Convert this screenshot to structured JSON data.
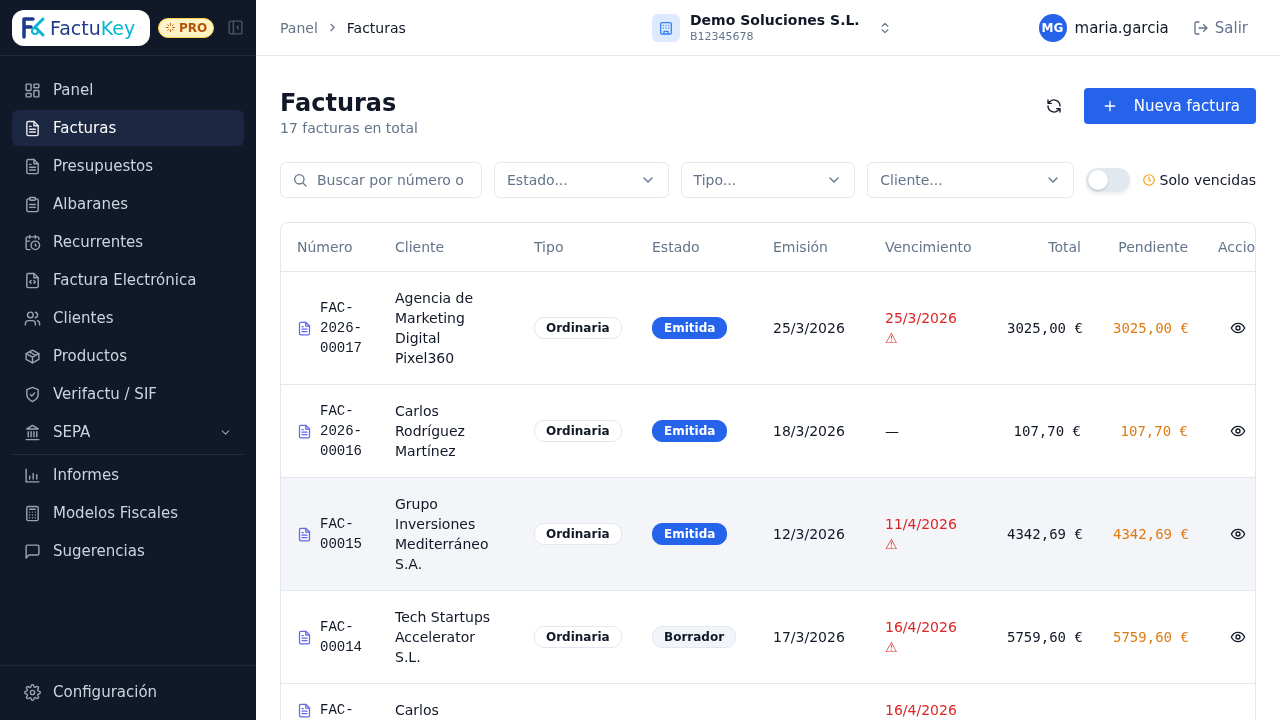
{
  "sidebar": {
    "logo": {
      "part_1": "Factu",
      "part_2": "Key"
    },
    "plan_badge": "PRO",
    "items": [
      {
        "label": "Panel",
        "selected": false
      },
      {
        "label": "Facturas",
        "selected": true
      },
      {
        "label": "Presupuestos",
        "selected": false
      },
      {
        "label": "Albaranes",
        "selected": false
      },
      {
        "label": "Recurrentes",
        "selected": false
      },
      {
        "label": "Factura Electrónica",
        "selected": false
      },
      {
        "label": "Clientes",
        "selected": false
      },
      {
        "label": "Productos",
        "selected": false
      },
      {
        "label": "Verifactu / SIF",
        "selected": false
      },
      {
        "label": "SEPA",
        "selected": false,
        "expanded": false
      },
      {
        "label": "Informes",
        "selected": false
      },
      {
        "label": "Modelos Fiscales",
        "selected": false
      },
      {
        "label": "Sugerencias",
        "selected": false
      }
    ],
    "footer_item": {
      "label": "Configuración",
      "selected": false
    }
  },
  "header": {
    "breadcrumb": [
      "Panel",
      "Facturas"
    ],
    "company": {
      "name": "Demo Soluciones S.L.",
      "tax_id": "B12345678"
    },
    "user": {
      "initials": "MG",
      "name": "maria.garcia"
    },
    "logout": "Salir"
  },
  "page": {
    "title": "Facturas",
    "subtitle": "17 facturas en total",
    "new_button": "Nueva factura"
  },
  "filters": {
    "search": {
      "placeholder": "Buscar por número o"
    },
    "selects": [
      {
        "placeholder": "Estado..."
      },
      {
        "placeholder": "Tipo..."
      },
      {
        "placeholder": "Cliente..."
      }
    ],
    "overdue_toggle": {
      "label": "Solo vencidas",
      "on": false
    }
  },
  "table": {
    "columns": [
      "Número",
      "Cliente",
      "Tipo",
      "Estado",
      "Emisión",
      "Vencimiento",
      "Total",
      "Pendiente",
      "Accio"
    ],
    "rows": [
      {
        "number": "FAC-2026-00017",
        "client": "Agencia de Marketing Digital Pixel360",
        "type": "Ordinaria",
        "status": {
          "label": "Emitida",
          "kind": "issued"
        },
        "issued": "25/3/2026",
        "due": "25/3/2026",
        "overdue": true,
        "due_flag": "⚠",
        "total": "3025,00 €",
        "pending": "3025,00 €",
        "highlighted": false
      },
      {
        "number": "FAC-2026-00016",
        "client": "Carlos Rodríguez Martínez",
        "type": "Ordinaria",
        "status": {
          "label": "Emitida",
          "kind": "issued"
        },
        "issued": "18/3/2026",
        "due": "—",
        "overdue": false,
        "total": "107,70 €",
        "pending": "107,70 €",
        "highlighted": false
      },
      {
        "number": "FAC-00015",
        "client": "Grupo Inversiones Mediterráneo S.A.",
        "type": "Ordinaria",
        "status": {
          "label": "Emitida",
          "kind": "issued"
        },
        "issued": "12/3/2026",
        "due": "11/4/2026",
        "overdue": true,
        "due_flag": "⚠",
        "total": "4342,69 €",
        "pending": "4342,69 €",
        "highlighted": true
      },
      {
        "number": "FAC-00014",
        "client": "Tech Startups Accelerator S.L.",
        "type": "Ordinaria",
        "status": {
          "label": "Borrador",
          "kind": "draft"
        },
        "issued": "17/3/2026",
        "due": "16/4/2026",
        "overdue": true,
        "due_flag": "⚠",
        "total": "5759,60 €",
        "pending": "5759,60 €",
        "highlighted": false
      },
      {
        "number": "FAC-",
        "client": "Carlos",
        "due": "16/4/2026",
        "overdue": true,
        "highlighted": false
      }
    ]
  }
}
